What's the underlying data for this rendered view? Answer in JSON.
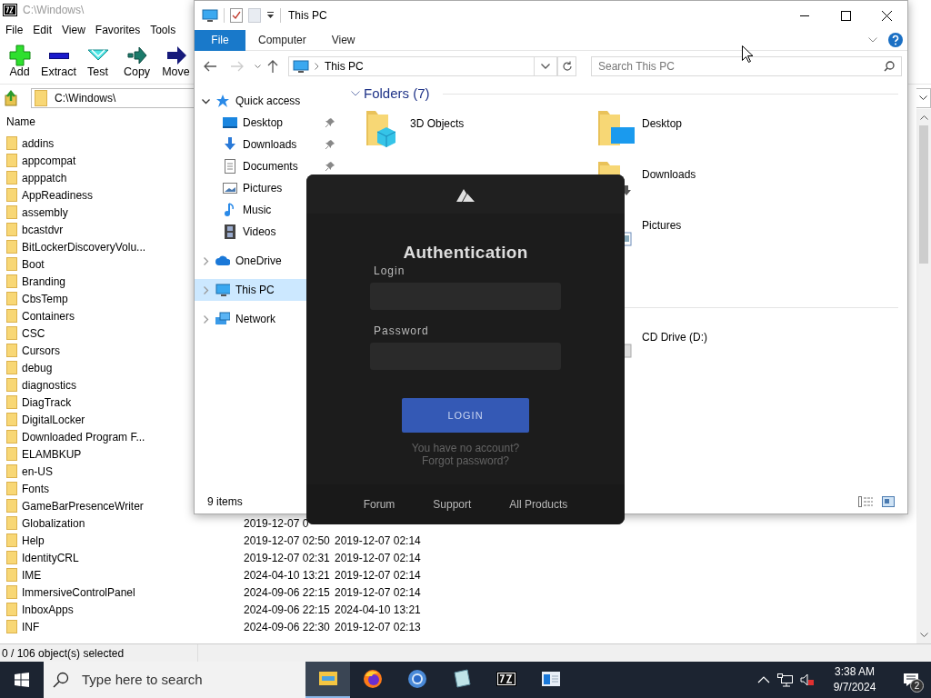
{
  "archiver": {
    "title": "C:\\Windows\\",
    "menu": [
      "File",
      "Edit",
      "View",
      "Favorites",
      "Tools"
    ],
    "toolbar": [
      {
        "label": "Add",
        "kind": "add"
      },
      {
        "label": "Extract",
        "kind": "extract"
      },
      {
        "label": "Test",
        "kind": "test"
      },
      {
        "label": "Copy",
        "kind": "copy"
      },
      {
        "label": "Move",
        "kind": "move"
      }
    ],
    "address": "C:\\Windows\\",
    "columns": [
      "Name"
    ],
    "rows": [
      {
        "name": "addins"
      },
      {
        "name": "appcompat"
      },
      {
        "name": "apppatch"
      },
      {
        "name": "AppReadiness"
      },
      {
        "name": "assembly"
      },
      {
        "name": "bcastdvr"
      },
      {
        "name": "BitLockerDiscoveryVolu..."
      },
      {
        "name": "Boot"
      },
      {
        "name": "Branding"
      },
      {
        "name": "CbsTemp"
      },
      {
        "name": "Containers"
      },
      {
        "name": "CSC"
      },
      {
        "name": "Cursors"
      },
      {
        "name": "debug"
      },
      {
        "name": "diagnostics"
      },
      {
        "name": "DiagTrack"
      },
      {
        "name": "DigitalLocker"
      },
      {
        "name": "Downloaded Program F..."
      },
      {
        "name": "ELAMBKUP"
      },
      {
        "name": "en-US"
      },
      {
        "name": "Fonts"
      },
      {
        "name": "GameBarPresenceWriter"
      },
      {
        "name": "Globalization",
        "modified": "2019-12-07 0"
      },
      {
        "name": "Help",
        "modified": "2019-12-07 02:50",
        "created": "2019-12-07 02:14"
      },
      {
        "name": "IdentityCRL",
        "modified": "2019-12-07 02:31",
        "created": "2019-12-07 02:14"
      },
      {
        "name": "IME",
        "modified": "2024-04-10 13:21",
        "created": "2019-12-07 02:14"
      },
      {
        "name": "ImmersiveControlPanel",
        "modified": "2024-09-06 22:15",
        "created": "2019-12-07 02:14"
      },
      {
        "name": "InboxApps",
        "modified": "2024-09-06 22:15",
        "created": "2024-04-10 13:21"
      },
      {
        "name": "INF",
        "modified": "2024-09-06 22:30",
        "created": "2019-12-07 02:13"
      }
    ],
    "status": "0 / 106 object(s) selected"
  },
  "explorer": {
    "title": "This PC",
    "ribbon_tabs": [
      {
        "label": "File",
        "selected": true
      },
      {
        "label": "Computer",
        "selected": false
      },
      {
        "label": "View",
        "selected": false
      }
    ],
    "address": "This PC",
    "search": {
      "placeholder": "Search This PC"
    },
    "nav": [
      {
        "label": "Quick access",
        "kind": "quick",
        "expanded": true,
        "selected": false,
        "children": [
          {
            "label": "Desktop",
            "kind": "desktop",
            "pinned": true,
            "selected": false
          },
          {
            "label": "Downloads",
            "kind": "downloads",
            "pinned": true,
            "selected": false
          },
          {
            "label": "Documents",
            "kind": "documents",
            "pinned": true,
            "selected": false
          },
          {
            "label": "Pictures",
            "kind": "pictures",
            "selected": false
          },
          {
            "label": "Music",
            "kind": "music",
            "selected": false
          },
          {
            "label": "Videos",
            "kind": "videos",
            "selected": false
          }
        ]
      },
      {
        "label": "OneDrive",
        "kind": "cloud",
        "expanded": false,
        "selected": false
      },
      {
        "label": "This PC",
        "kind": "pc",
        "expanded": false,
        "selected": true
      },
      {
        "label": "Network",
        "kind": "network",
        "expanded": false,
        "selected": false
      }
    ],
    "section": "Folders (7)",
    "folders": [
      {
        "label": "3D Objects",
        "kind": "objects3d"
      },
      {
        "label": "Desktop",
        "kind": "desktop"
      },
      {
        "label": "Downloads",
        "kind": "downloads"
      },
      {
        "label": "Pictures",
        "kind": "pictures"
      }
    ],
    "drives": [
      {
        "label": "CD Drive (D:)",
        "kind": "cd"
      }
    ],
    "status": "9 items"
  },
  "auth": {
    "title": "Authentication",
    "fields": [
      {
        "label": "Login"
      },
      {
        "label": "Password"
      }
    ],
    "button": "LOGIN",
    "links": [
      "You have no account?",
      "Forgot password?"
    ],
    "footer": [
      "Forum",
      "Support",
      "All Products"
    ]
  },
  "taskbar": {
    "search": {
      "placeholder": "Type here to search"
    },
    "apps": [
      {
        "kind": "explorer",
        "active": true
      },
      {
        "kind": "firefox",
        "active": false
      },
      {
        "kind": "chrome",
        "active": false
      },
      {
        "kind": "notepad",
        "active": false
      },
      {
        "kind": "sevenzip",
        "active": false
      },
      {
        "kind": "window",
        "active": false
      }
    ],
    "time": "3:38 AM",
    "date": "9/7/2024",
    "notifications": "2"
  }
}
